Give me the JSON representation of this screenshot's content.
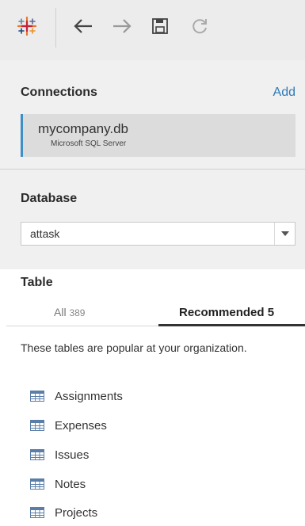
{
  "toolbar": {
    "logo_icon": "tableau-logo-icon",
    "back_icon": "arrow-left-icon",
    "forward_icon": "arrow-right-icon",
    "save_icon": "save-icon",
    "refresh_icon": "refresh-icon"
  },
  "connections": {
    "heading": "Connections",
    "add_label": "Add",
    "items": [
      {
        "name": "mycompany.db",
        "type": "Microsoft SQL Server"
      }
    ]
  },
  "database": {
    "heading": "Database",
    "selected": "attask"
  },
  "table": {
    "heading": "Table",
    "tabs": [
      {
        "label": "All",
        "count": "389"
      },
      {
        "label": "Recommended",
        "count": "5"
      }
    ],
    "active_tab": "Recommended",
    "hint": "These tables are popular at your organization.",
    "items": [
      {
        "label": "Assignments"
      },
      {
        "label": "Expenses"
      },
      {
        "label": "Issues"
      },
      {
        "label": "Notes"
      },
      {
        "label": "Projects"
      }
    ]
  },
  "colors": {
    "accent": "#3f8ec6",
    "link": "#2e7ab6"
  }
}
